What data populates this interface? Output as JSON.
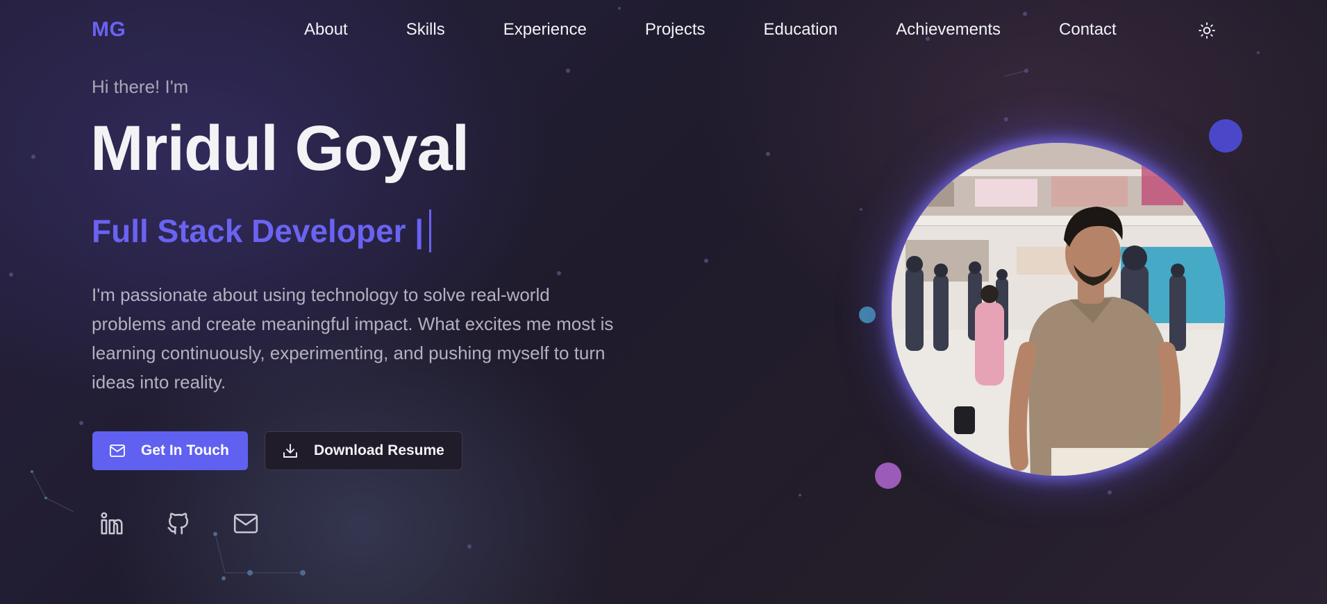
{
  "nav": {
    "logo": "MG",
    "links": [
      "About",
      "Skills",
      "Experience",
      "Projects",
      "Education",
      "Achievements",
      "Contact"
    ],
    "theme_toggle_icon": "sun-icon"
  },
  "hero": {
    "greeting": "Hi there! I'm",
    "name": "Mridul Goyal",
    "role": "Full Stack Developer |",
    "bio": "I'm passionate about using technology to solve real-world problems and create meaningful impact. What excites me most is learning continuously, experimenting, and pushing myself to turn ideas into reality.",
    "primary_button": {
      "label": "Get In Touch",
      "icon": "mail-icon"
    },
    "secondary_button": {
      "label": "Download Resume",
      "icon": "download-icon"
    },
    "social": [
      "linkedin-icon",
      "github-icon",
      "mail-icon"
    ]
  },
  "colors": {
    "accent": "#6a63f2",
    "button_primary": "#6061f0",
    "dot_indigo": "#4c47c9",
    "dot_teal": "#3f86a8",
    "dot_purple": "#9a5cb8"
  }
}
